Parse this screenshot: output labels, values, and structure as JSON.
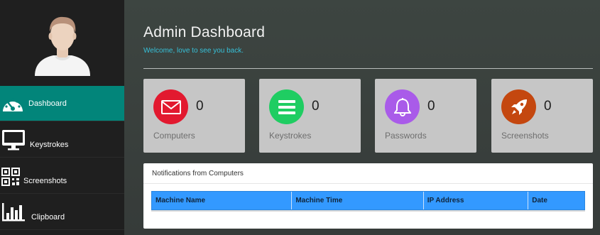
{
  "sidebar": {
    "items": [
      {
        "label": "Dashboard",
        "icon": "dashboard-gauge-icon",
        "active": true
      },
      {
        "label": "Keystrokes",
        "icon": "monitor-icon",
        "active": false
      },
      {
        "label": "Screenshots",
        "icon": "qr-code-icon",
        "active": false
      },
      {
        "label": "Clipboard",
        "icon": "bar-chart-icon",
        "active": false
      }
    ]
  },
  "header": {
    "title": "Admin Dashboard",
    "subtitle": "Welcome, love to see you back."
  },
  "cards": [
    {
      "label": "Computers",
      "count": "0",
      "icon": "envelope-icon",
      "color": "#e2192f"
    },
    {
      "label": "Keystrokes",
      "count": "0",
      "icon": "list-icon",
      "color": "#1fcd62"
    },
    {
      "label": "Passwords",
      "count": "0",
      "icon": "bell-icon",
      "color": "#a95be9"
    },
    {
      "label": "Screenshots",
      "count": "0",
      "icon": "rocket-icon",
      "color": "#c4470f"
    }
  ],
  "notifications": {
    "title": "Notifications from Computers",
    "columns": [
      "Machine Name",
      "Machine Time",
      "IP Address",
      "Date"
    ]
  },
  "colors": {
    "accent": "#02857a",
    "subtitle": "#37c0d8",
    "table_header": "#3399ff"
  }
}
